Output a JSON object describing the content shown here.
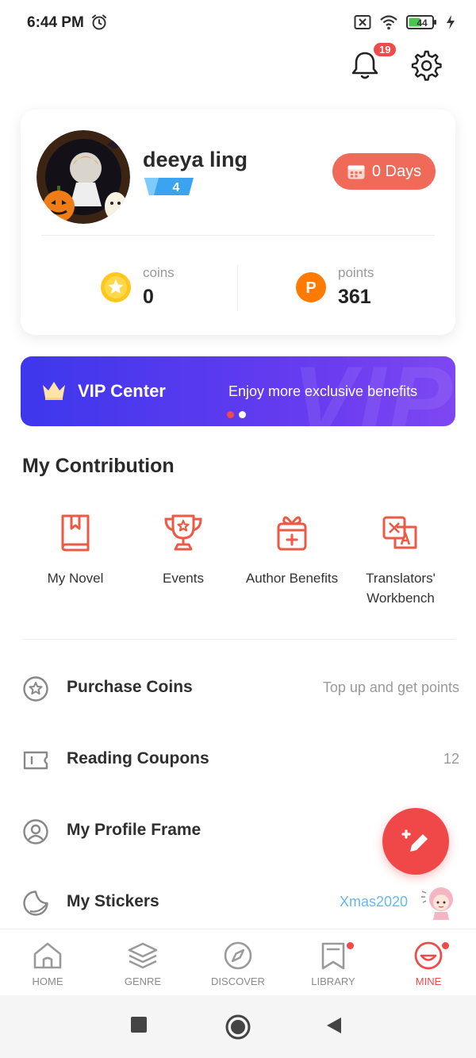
{
  "status_bar": {
    "time": "6:44 PM",
    "battery": "44"
  },
  "notifications": {
    "badge_count": "19"
  },
  "profile": {
    "username": "deeya ling",
    "level": "4",
    "days_label": "0 Days",
    "coins_label": "coins",
    "coins_value": "0",
    "points_label": "points",
    "points_value": "361"
  },
  "vip_banner": {
    "title": "VIP Center",
    "subtitle": "Enjoy more exclusive benefits",
    "watermark": "VIP",
    "active_dot": 0,
    "dot_count": 2
  },
  "contribution": {
    "title": "My Contribution",
    "items": [
      {
        "label": "My Novel",
        "icon": "book-icon"
      },
      {
        "label": "Events",
        "icon": "trophy-icon"
      },
      {
        "label": "Author Benefits",
        "icon": "gift-icon"
      },
      {
        "label": "Translators' Workbench",
        "icon": "translate-icon"
      }
    ]
  },
  "menu": [
    {
      "label": "Purchase Coins",
      "right": "Top up and get points",
      "icon": "coin-star-icon"
    },
    {
      "label": "Reading Coupons",
      "right": "12",
      "icon": "coupon-icon"
    },
    {
      "label": "My Profile Frame",
      "right": "",
      "icon": "profile-frame-icon"
    },
    {
      "label": "My Stickers",
      "right": "Xmas2020",
      "icon": "sticker-icon"
    }
  ],
  "bottom_nav": [
    {
      "label": "HOME",
      "icon": "home-icon",
      "active": false,
      "dot": false
    },
    {
      "label": "GENRE",
      "icon": "layers-icon",
      "active": false,
      "dot": false
    },
    {
      "label": "DISCOVER",
      "icon": "compass-icon",
      "active": false,
      "dot": false
    },
    {
      "label": "LIBRARY",
      "icon": "bookmark-icon",
      "active": false,
      "dot": true
    },
    {
      "label": "MINE",
      "icon": "mine-icon",
      "active": true,
      "dot": true
    }
  ],
  "colors": {
    "accent": "#f04a4a",
    "days_button": "#f06a59",
    "vip_start": "#3d37ec",
    "vip_end": "#7e47f2",
    "icon_red": "#ea5a45"
  }
}
